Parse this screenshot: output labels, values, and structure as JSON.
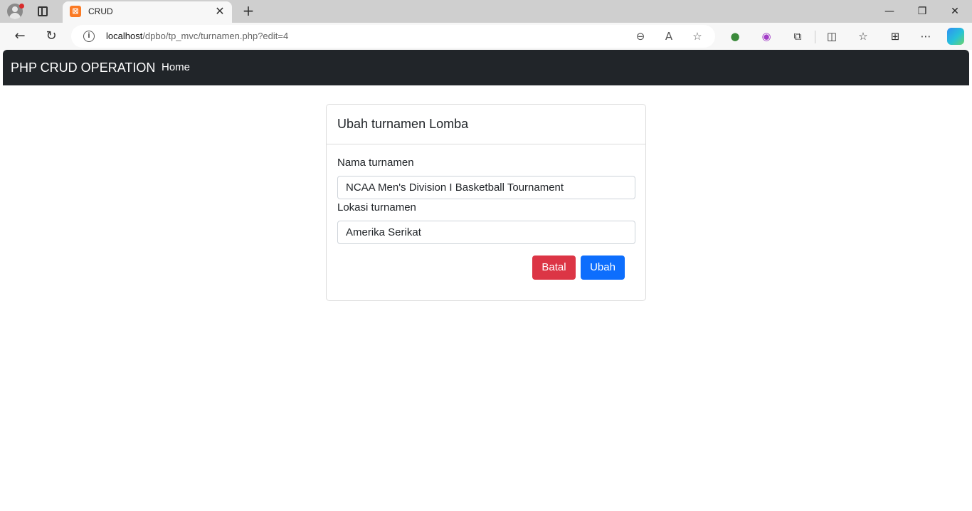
{
  "browser": {
    "tab_title": "CRUD",
    "favicon_text": "⊠",
    "url_host": "localhost",
    "url_path": "/dpbo/tp_mvc/turnamen.php?edit=4"
  },
  "navbar": {
    "brand": "PHP CRUD OPERATION",
    "home_link": "Home"
  },
  "form": {
    "title": "Ubah turnamen Lomba",
    "nama_label": "Nama turnamen",
    "nama_value": "NCAA Men's Division I Basketball Tournament",
    "lokasi_label": "Lokasi turnamen",
    "lokasi_value": "Amerika Serikat",
    "cancel_label": "Batal",
    "submit_label": "Ubah"
  },
  "colors": {
    "navbar": "#212529",
    "danger": "#dc3545",
    "primary": "#0d6efd"
  }
}
